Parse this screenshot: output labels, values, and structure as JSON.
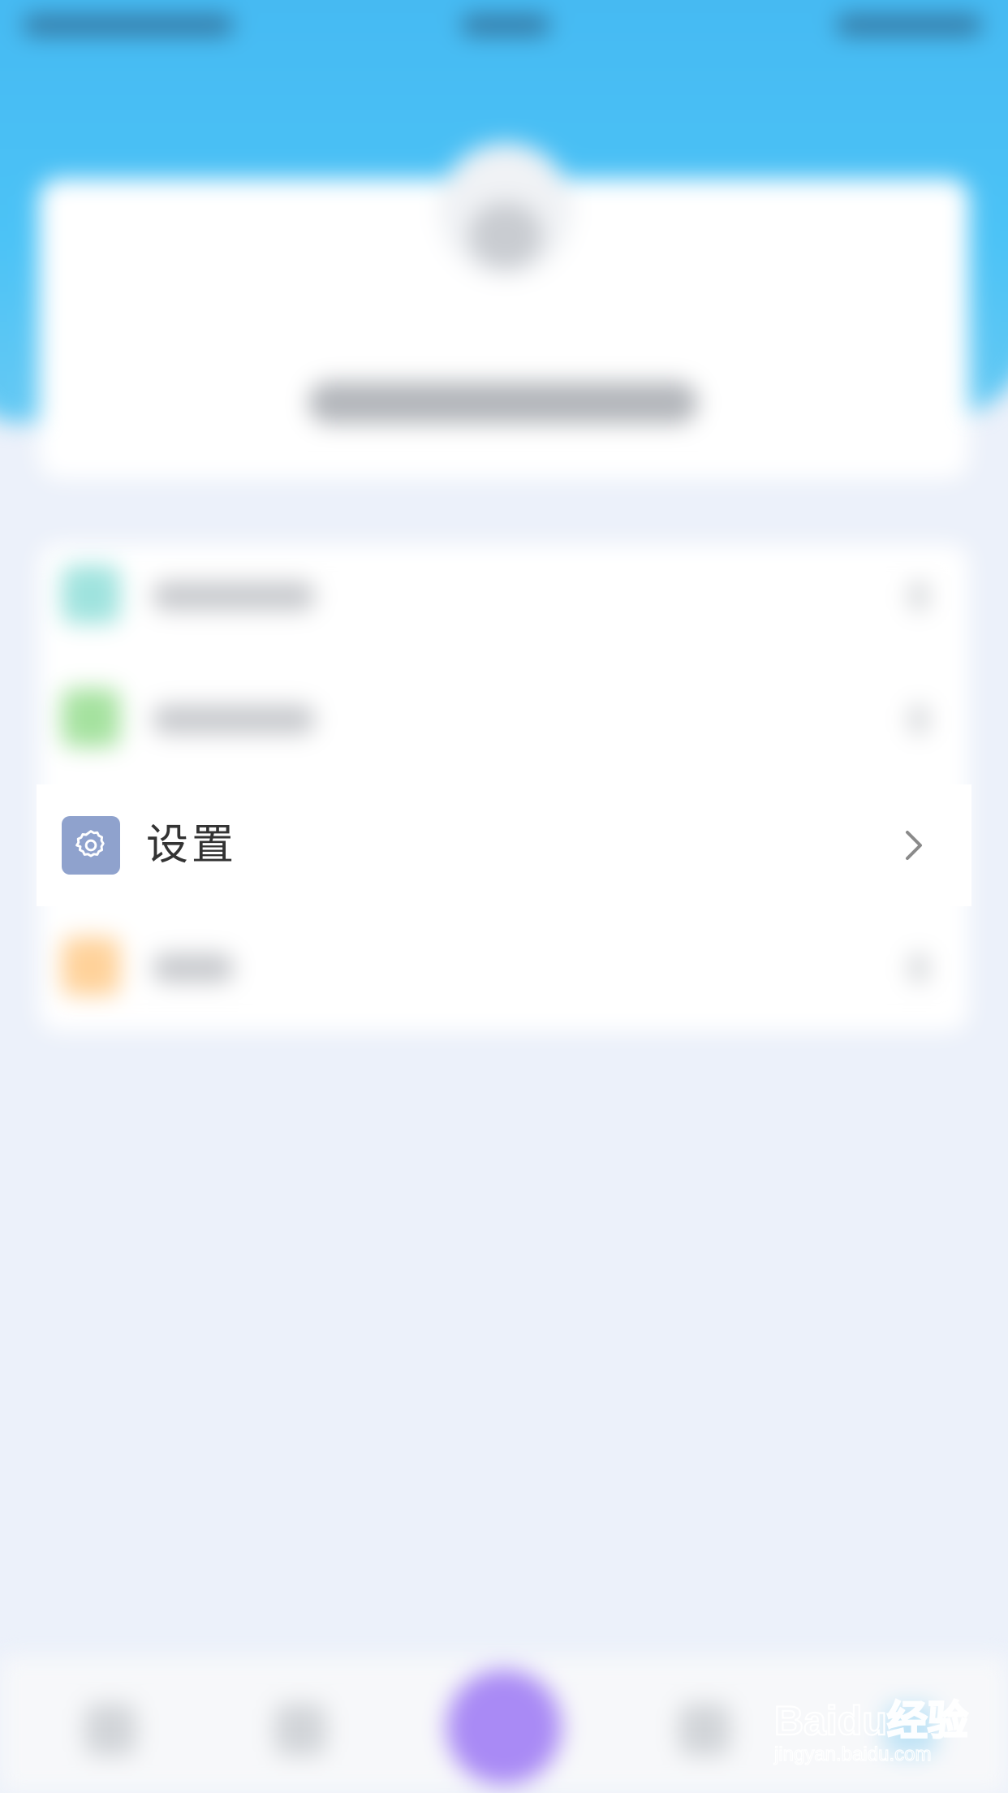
{
  "settings_row": {
    "label": "设置",
    "icon": "gear-icon",
    "chevron_icon": "chevron-right-icon"
  },
  "watermark": {
    "brand": "Baidu经验",
    "url": "jingyan.baidu.com"
  },
  "colors": {
    "header_blue": "#4cc3f6",
    "settings_icon_bg": "#8fa2cd",
    "menu_icon_1": "#9fe3de",
    "menu_icon_2": "#a5e29f",
    "menu_icon_3": "#ffd29a",
    "center_button": "#a98af5",
    "page_bg": "#ecf1fa"
  }
}
